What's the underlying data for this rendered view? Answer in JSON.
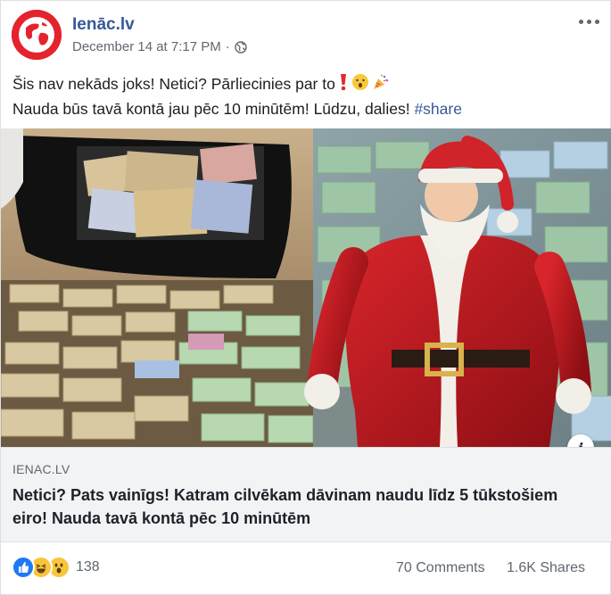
{
  "post": {
    "page_name": "Ienāc.lv",
    "timestamp": "December 14 at 7:17 PM",
    "separator": "·",
    "text_line1": "Šis nav nekāds joks! Netici? Pārliecinies par to",
    "text_line2_prefix": "Nauda būs tavā kontā jau pēc 10 minūtēm! Lūdzu, dalies!",
    "hashtag": "#share",
    "icons": [
      "globe-icon",
      "more-icon",
      "exclamation-icon",
      "hushed-face-icon",
      "confetti-icon",
      "info-icon"
    ]
  },
  "link": {
    "domain": "IENAC.LV",
    "title": "Netici? Pats vainīgs! Katram cilvēkam dāvinam naudu līdz 5 tūkstošiem eiro! Nauda tavā kontā pēc 10 minūtēm"
  },
  "footer": {
    "reaction_count": "138",
    "comments": "70 Comments",
    "shares": "1.6K Shares",
    "reaction_icons": [
      "like-icon",
      "haha-icon",
      "wow-icon"
    ]
  },
  "colors": {
    "brand_link": "#385898",
    "avatar_red": "#e4232c",
    "meta_gray": "#606770",
    "link_bg": "#f2f3f5"
  }
}
